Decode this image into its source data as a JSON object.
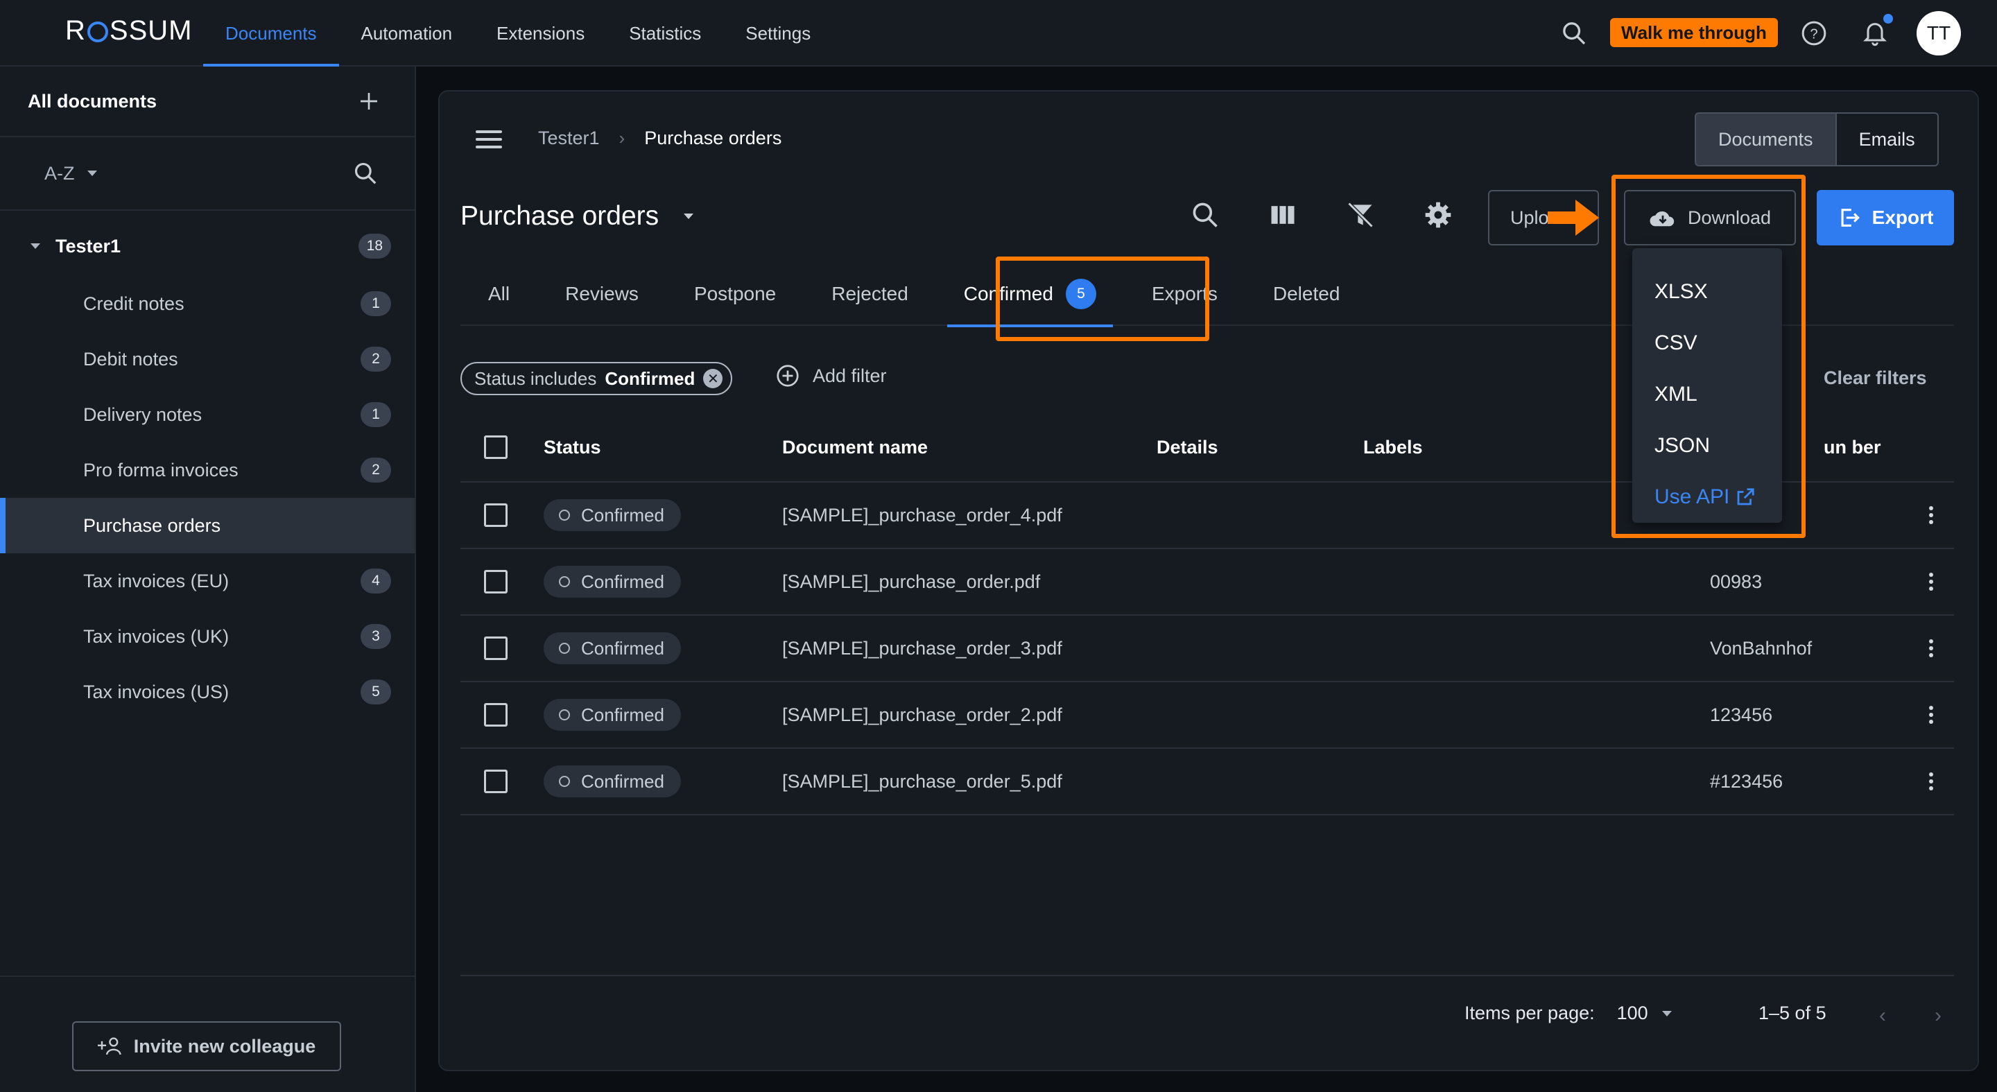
{
  "app": {
    "logo": "ROSSUM",
    "nav": [
      "Documents",
      "Automation",
      "Extensions",
      "Statistics",
      "Settings"
    ],
    "walk_me_through": "Walk me through",
    "avatar_initials": "TT",
    "accent_color": "#3b86f5",
    "highlight_color": "#ff7a00"
  },
  "sidebar": {
    "title": "All documents",
    "sort_label": "A-Z",
    "root": {
      "label": "Tester1",
      "count": "18"
    },
    "items": [
      {
        "label": "Credit notes",
        "count": "1"
      },
      {
        "label": "Debit notes",
        "count": "2"
      },
      {
        "label": "Delivery notes",
        "count": "1"
      },
      {
        "label": "Pro forma invoices",
        "count": "2"
      },
      {
        "label": "Purchase orders",
        "count": ""
      },
      {
        "label": "Tax invoices (EU)",
        "count": "4"
      },
      {
        "label": "Tax invoices (UK)",
        "count": "3"
      },
      {
        "label": "Tax invoices (US)",
        "count": "5"
      }
    ],
    "invite_label": "Invite new colleague"
  },
  "main": {
    "breadcrumb": [
      "Tester1",
      "Purchase orders"
    ],
    "view_toggle": [
      "Documents",
      "Emails"
    ],
    "title": "Purchase orders",
    "upload_label": "Uplo",
    "download_label": "Download",
    "export_label": "Export",
    "tabs": [
      "All",
      "Reviews",
      "Postpone",
      "Rejected",
      "Confirmed",
      "Exports",
      "Deleted"
    ],
    "confirmed_count": "5",
    "filter": {
      "prefix": "Status includes",
      "value": "Confirmed"
    },
    "add_filter": "Add filter",
    "clear_filters": "Clear filters",
    "columns": [
      "Status",
      "Document name",
      "Details",
      "Labels",
      "un ber"
    ],
    "rows": [
      {
        "status": "Confirmed",
        "name": "[SAMPLE]_purchase_order_4.pdf",
        "number": ""
      },
      {
        "status": "Confirmed",
        "name": "[SAMPLE]_purchase_order.pdf",
        "number": "00983"
      },
      {
        "status": "Confirmed",
        "name": "[SAMPLE]_purchase_order_3.pdf",
        "number": "VonBahnhof"
      },
      {
        "status": "Confirmed",
        "name": "[SAMPLE]_purchase_order_2.pdf",
        "number": "123456"
      },
      {
        "status": "Confirmed",
        "name": "[SAMPLE]_purchase_order_5.pdf",
        "number": "#123456"
      }
    ],
    "items_per_page_label": "Items per page:",
    "items_per_page": "100",
    "range": "1–5 of 5"
  },
  "download_menu": {
    "items": [
      "XLSX",
      "CSV",
      "XML",
      "JSON"
    ],
    "api_label": "Use API"
  }
}
